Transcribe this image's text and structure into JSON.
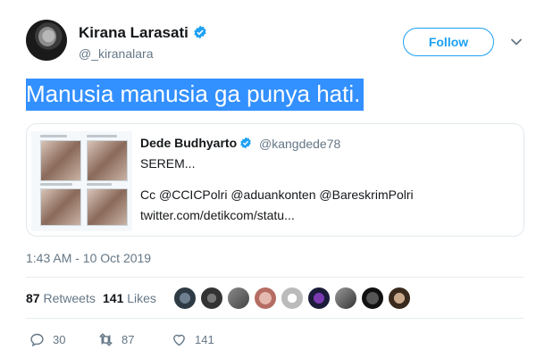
{
  "author": {
    "name": "Kirana Larasati",
    "handle": "@_kiranalara"
  },
  "follow_label": "Follow",
  "tweet_text": "Manusia manusia ga punya hati.",
  "quoted": {
    "name": "Dede Budhyarto",
    "handle": "@kangdede78",
    "line1": "SEREM...",
    "line2": "Cc @CCICPolri @aduankonten @BareskrimPolri",
    "line3": "twitter.com/detikcom/statu..."
  },
  "timestamp": "1:43 AM - 10 Oct 2019",
  "stats": {
    "retweets_count": "87",
    "retweets_label": "Retweets",
    "likes_count": "141",
    "likes_label": "Likes"
  },
  "actions": {
    "replies": "30",
    "retweets": "87",
    "likes": "141"
  },
  "colors": {
    "accent": "#1da1f2",
    "selection": "#3390ff",
    "muted": "#657786"
  },
  "liker_avatars": 9
}
